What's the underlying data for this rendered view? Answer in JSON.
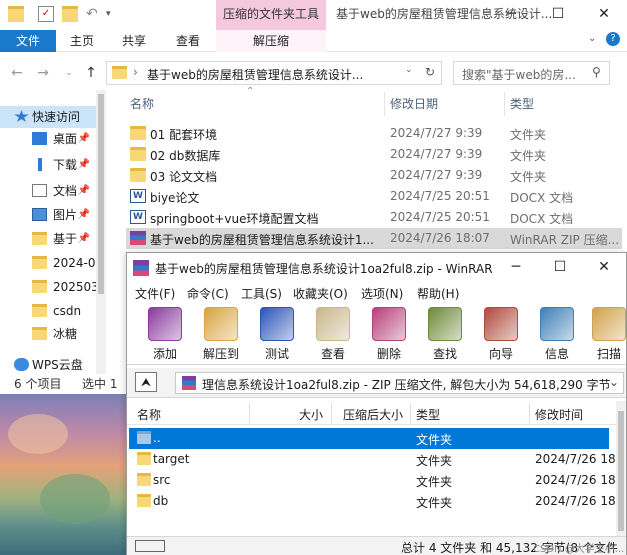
{
  "explorer": {
    "title": "基于web的房屋租赁管理信息系统设计...",
    "context_tab_header": "压缩的文件夹工具",
    "tabs": [
      "文件",
      "主页",
      "共享",
      "查看"
    ],
    "context_tab": "解压缩",
    "address": "基于web的房屋租赁管理信息系统设计...",
    "search_placeholder": "搜索\"基于web的房...",
    "columns": {
      "name": "名称",
      "date": "修改日期",
      "type": "类型"
    },
    "files": [
      {
        "name": "01 配套环境",
        "date": "2024/7/27 9:39",
        "type": "文件夹",
        "icon": "folder-icon"
      },
      {
        "name": "02 db数据库",
        "date": "2024/7/27 9:39",
        "type": "文件夹",
        "icon": "folder-icon"
      },
      {
        "name": "03 论文文档",
        "date": "2024/7/27 9:39",
        "type": "文件夹",
        "icon": "folder-icon"
      },
      {
        "name": "biye论文",
        "date": "2024/7/25 20:51",
        "type": "DOCX 文档",
        "icon": "word-doc-icon"
      },
      {
        "name": "springboot+vue环境配置文档",
        "date": "2024/7/25 20:51",
        "type": "DOCX 文档",
        "icon": "word-doc-icon"
      },
      {
        "name": "基于web的房屋租赁管理信息系统设计1...",
        "date": "2024/7/26 18:07",
        "type": "WinRAR ZIP 压缩...",
        "icon": "winrar-archive-icon"
      }
    ],
    "nav": [
      {
        "label": "快速访问",
        "icon": "star-icon"
      },
      {
        "label": "桌面",
        "icon": "desktop-icon",
        "pinned": true
      },
      {
        "label": "下载",
        "icon": "download-icon",
        "pinned": true
      },
      {
        "label": "文档",
        "icon": "document-icon",
        "pinned": true
      },
      {
        "label": "图片",
        "icon": "picture-icon",
        "pinned": true
      },
      {
        "label": "基于",
        "icon": "folder-icon",
        "pinned": true
      },
      {
        "label": "2024-0",
        "icon": "folder-icon"
      },
      {
        "label": "202503",
        "icon": "folder-icon"
      },
      {
        "label": "csdn",
        "icon": "folder-icon"
      },
      {
        "label": "冰糖",
        "icon": "folder-icon"
      },
      {
        "label": "WPS云盘",
        "icon": "cloud-icon"
      }
    ],
    "status_items": "6 个项目",
    "status_selected": "选中 1"
  },
  "winrar": {
    "title": "基于web的房屋租赁管理信息系统设计1oa2ful8.zip - WinRAR",
    "menu": [
      "文件(F)",
      "命令(C)",
      "工具(S)",
      "收藏夹(O)",
      "选项(N)",
      "帮助(H)"
    ],
    "toolbar": [
      {
        "label": "添加",
        "icon": "add-archive-icon",
        "color": "#8b3a9e"
      },
      {
        "label": "解压到",
        "icon": "extract-to-icon",
        "color": "#d9a441"
      },
      {
        "label": "测试",
        "icon": "test-icon",
        "color": "#2c55b8"
      },
      {
        "label": "查看",
        "icon": "view-icon",
        "color": "#c9b68c"
      },
      {
        "label": "删除",
        "icon": "delete-icon",
        "color": "#b6407b"
      },
      {
        "label": "查找",
        "icon": "find-icon",
        "color": "#6f8a3a"
      },
      {
        "label": "向导",
        "icon": "wizard-icon",
        "color": "#b04a3c"
      },
      {
        "label": "信息",
        "icon": "info-icon",
        "color": "#3f7fb7"
      },
      {
        "label": "扫描",
        "icon": "scan-icon",
        "color": "#d2a14a"
      }
    ],
    "path": "理信息系统设计1oa2ful8.zip - ZIP 压缩文件, 解包大小为 54,618,290 字节",
    "columns": {
      "name": "名称",
      "size": "大小",
      "packed": "压缩后大小",
      "type": "类型",
      "modified": "修改时间"
    },
    "rows": [
      {
        "name": "..",
        "type": "文件夹",
        "date": ""
      },
      {
        "name": "target",
        "type": "文件夹",
        "date": "2024/7/26 18"
      },
      {
        "name": "src",
        "type": "文件夹",
        "date": "2024/7/26 18"
      },
      {
        "name": "db",
        "type": "文件夹",
        "date": "2024/7/26 18"
      }
    ],
    "status": "总计 4 文件夹 和 45,132 字节(8 个文件",
    "watermark": "CSDN @大学生小..."
  }
}
